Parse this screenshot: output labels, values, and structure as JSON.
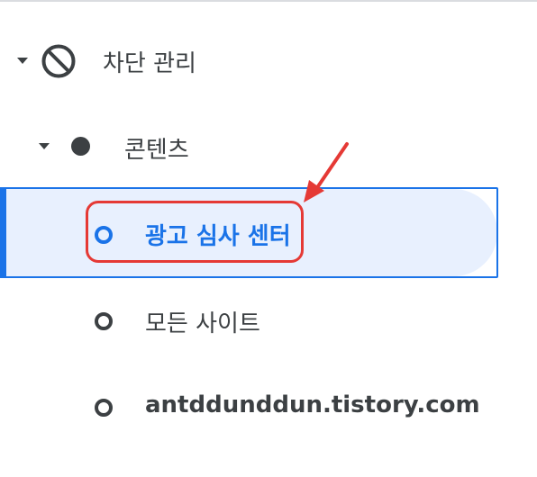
{
  "colors": {
    "accent": "#1a73e8",
    "selected_bg": "#e8f0fe",
    "text": "#3c4043",
    "annotation_red": "#e53935"
  },
  "nav": {
    "block_management": {
      "label": "차단 관리",
      "icon": "block-icon",
      "expanded": true
    },
    "content": {
      "label": "콘텐츠",
      "icon": "filled-dot-icon",
      "expanded": true
    },
    "items": [
      {
        "label": "광고 심사 센터",
        "icon": "hollow-circle-icon",
        "selected": true
      },
      {
        "label": "모든 사이트",
        "icon": "hollow-circle-icon",
        "selected": false
      },
      {
        "label": "antddunddun.tistory.com",
        "icon": "hollow-circle-icon",
        "selected": false
      }
    ]
  },
  "annotation": {
    "type": "red-arrow-and-box",
    "target": "광고 심사 센터"
  }
}
